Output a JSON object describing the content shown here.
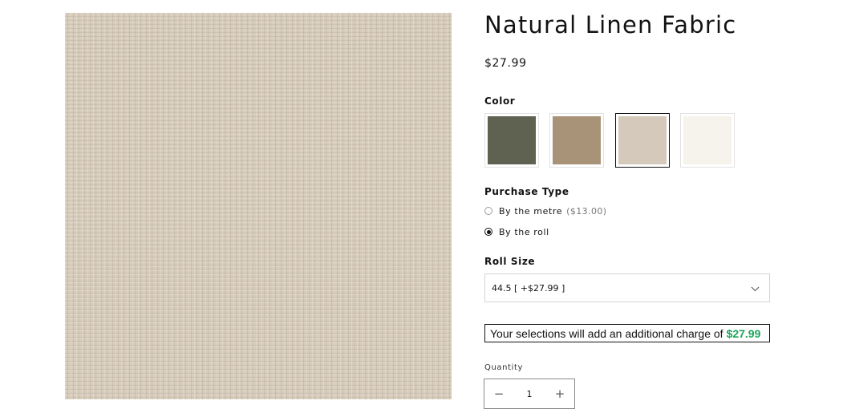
{
  "product": {
    "title": "Natural Linen Fabric",
    "price": "$27.99",
    "image_alt": "natural linen fabric texture"
  },
  "color": {
    "label": "Color",
    "options": [
      {
        "name": "olive",
        "hex": "#5f6151"
      },
      {
        "name": "flax",
        "hex": "#a89379"
      },
      {
        "name": "natural",
        "hex": "#d4c9bb",
        "selected": true
      },
      {
        "name": "white",
        "hex": "#f5f3ec"
      }
    ]
  },
  "purchase_type": {
    "label": "Purchase Type",
    "options": [
      {
        "label": "By the metre",
        "extra": "($13.00)",
        "checked": false
      },
      {
        "label": "By the roll",
        "extra": "",
        "checked": true
      }
    ]
  },
  "roll_size": {
    "label": "Roll Size",
    "selected": "44.5 [ +$27.99 ]"
  },
  "notice": {
    "text": "Your selections will add an additional charge of",
    "amount": "$27.99",
    "amount_color": "#1aa55a"
  },
  "quantity": {
    "label": "Quantity",
    "value": "1",
    "minus": "−",
    "plus": "+"
  }
}
